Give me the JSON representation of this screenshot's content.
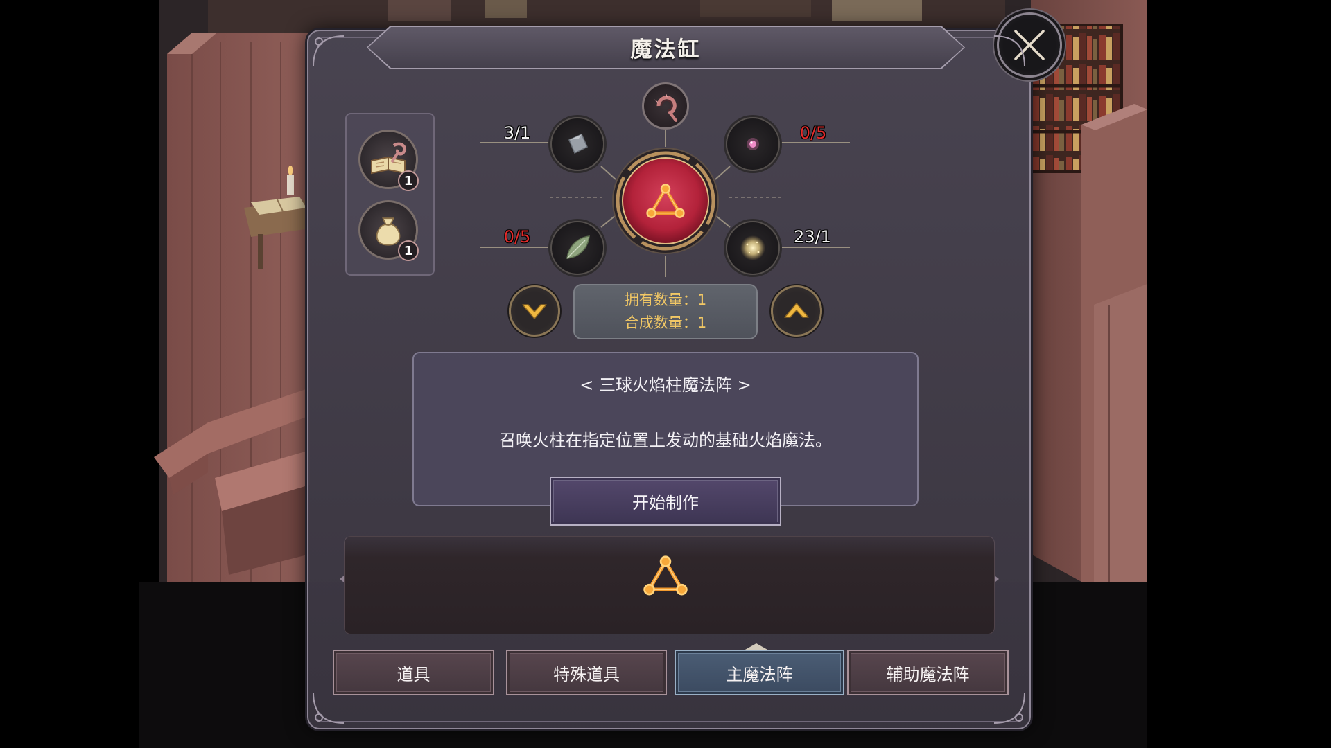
{
  "window": {
    "title": "魔法缸"
  },
  "close_button": {
    "icon": "close-icon"
  },
  "inventory": {
    "items": [
      {
        "icon": "spell-book-icon",
        "count": "1"
      },
      {
        "icon": "pouch-icon",
        "count": "1"
      }
    ]
  },
  "recipe": {
    "result_icon": "triangle-magic-circle-icon",
    "catalyst_icon": "magic-staff-icon",
    "ingredients": [
      {
        "icon": "stone-shard-icon",
        "count": "3/1",
        "sufficient": true
      },
      {
        "icon": "pink-gem-icon",
        "count": "0/5",
        "sufficient": false
      },
      {
        "icon": "leaf-icon",
        "count": "0/5",
        "sufficient": false
      },
      {
        "icon": "golden-dust-icon",
        "count": "23/1",
        "sufficient": true
      }
    ]
  },
  "quantity": {
    "owned_label": "拥有数量：",
    "owned_value": "1",
    "craft_label": "合成数量：",
    "craft_value": "1",
    "decrease_icon": "chevron-down-icon",
    "increase_icon": "chevron-up-icon"
  },
  "description": {
    "title": "< 三球火焰柱魔法阵 >",
    "text": "召唤火柱在指定位置上发动的基础火焰魔法。"
  },
  "craft_button": {
    "label": "开始制作"
  },
  "preview": {
    "icon": "triangle-magic-circle-icon"
  },
  "tabs": [
    {
      "label": "道具",
      "selected": false
    },
    {
      "label": "特殊道具",
      "selected": false
    },
    {
      "label": "主魔法阵",
      "selected": true
    },
    {
      "label": "辅助魔法阵",
      "selected": false
    }
  ],
  "colors": {
    "text_gold": "#f2c865",
    "insufficient_red": "#e52a2a",
    "recipe_red": "#b3223a",
    "selected_tab": "#3b4a60"
  }
}
